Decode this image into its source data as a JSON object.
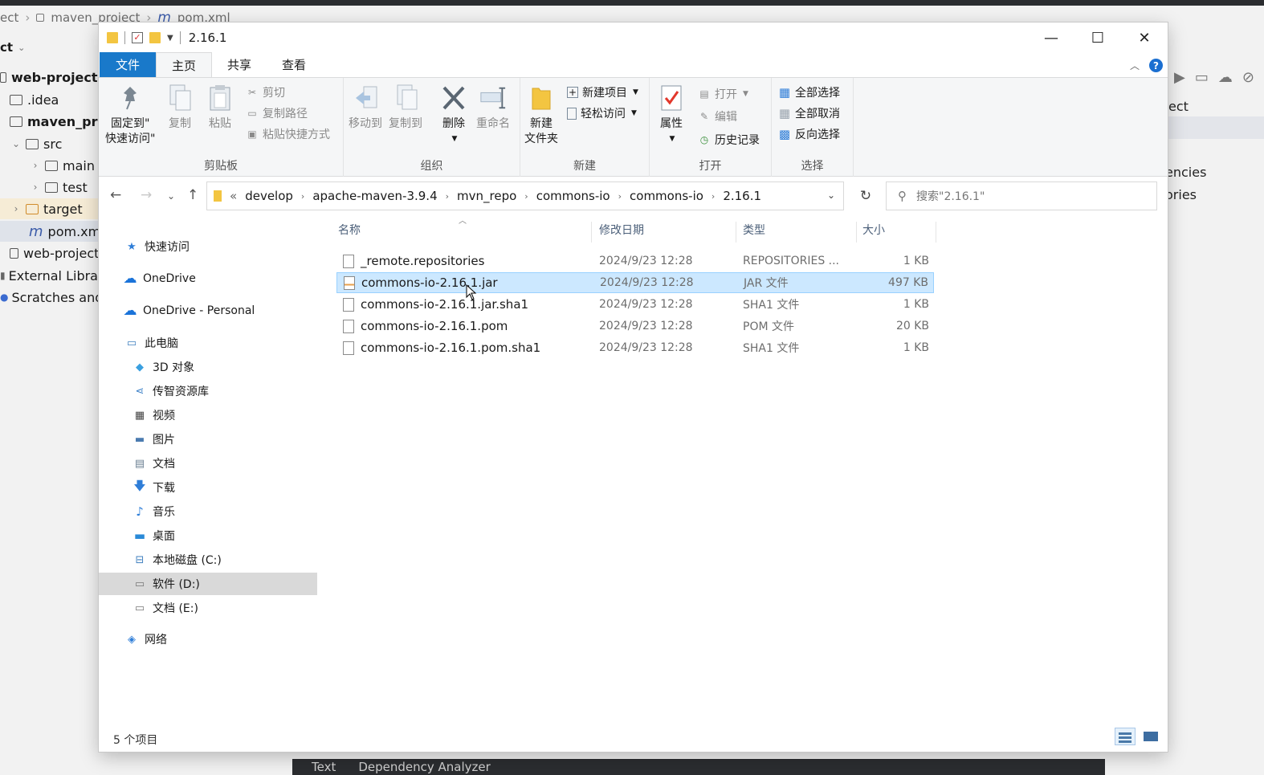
{
  "ide": {
    "breadcrumb": [
      "ect",
      "maven_project",
      "pom.xml"
    ],
    "project_label": "ct",
    "tree": [
      {
        "label": "web-project",
        "bold": true
      },
      {
        "label": ".idea"
      },
      {
        "label": "maven_pro",
        "bold": true
      },
      {
        "label": "src"
      },
      {
        "label": "main"
      },
      {
        "label": "test"
      },
      {
        "label": "target"
      },
      {
        "label": "pom.xml"
      },
      {
        "label": "web-project"
      },
      {
        "label": "External Librari"
      },
      {
        "label": "Scratches and"
      }
    ],
    "right_texts": [
      "ect",
      "encies",
      "ories"
    ],
    "bottom_tabs": [
      "Text",
      "Dependency Analyzer"
    ]
  },
  "window": {
    "title": "2.16.1",
    "buttons": {
      "minimize": "—",
      "maximize": "☐",
      "close": "✕"
    }
  },
  "tabs": {
    "file": "文件",
    "home": "主页",
    "share": "共享",
    "view": "查看"
  },
  "ribbon": {
    "clipboard": {
      "label": "剪贴板",
      "pin": "固定到\"\n快速访问\"",
      "pin_l1": "固定到\"",
      "pin_l2": "快速访问\"",
      "copy": "复制",
      "paste": "粘贴",
      "cut": "剪切",
      "copy_path": "复制路径",
      "paste_shortcut": "粘贴快捷方式"
    },
    "organize": {
      "label": "组织",
      "move_to": "移动到",
      "copy_to": "复制到",
      "delete": "删除",
      "rename": "重命名"
    },
    "new": {
      "label": "新建",
      "new_folder_l1": "新建",
      "new_folder_l2": "文件夹",
      "new_item": "新建项目",
      "easy_access": "轻松访问"
    },
    "open": {
      "label": "打开",
      "properties": "属性",
      "open": "打开",
      "edit": "编辑",
      "history": "历史记录"
    },
    "select": {
      "label": "选择",
      "select_all": "全部选择",
      "select_none": "全部取消",
      "invert": "反向选择"
    }
  },
  "address": {
    "prefix": "«",
    "crumbs": [
      "develop",
      "apache-maven-3.9.4",
      "mvn_repo",
      "commons-io",
      "commons-io",
      "2.16.1"
    ],
    "search_placeholder": "搜索\"2.16.1\""
  },
  "nav": [
    {
      "label": "快速访问",
      "icon": "star-icon"
    },
    {
      "label": "OneDrive",
      "icon": "cloud-icon"
    },
    {
      "label": "OneDrive - Personal",
      "icon": "cloud-icon"
    },
    {
      "label": "此电脑",
      "icon": "computer-icon"
    },
    {
      "label": "3D 对象",
      "icon": "cube-icon"
    },
    {
      "label": "传智资源库",
      "icon": "share-icon"
    },
    {
      "label": "视频",
      "icon": "video-icon"
    },
    {
      "label": "图片",
      "icon": "picture-icon"
    },
    {
      "label": "文档",
      "icon": "document-icon"
    },
    {
      "label": "下载",
      "icon": "download-icon"
    },
    {
      "label": "音乐",
      "icon": "music-icon"
    },
    {
      "label": "桌面",
      "icon": "desktop-icon"
    },
    {
      "label": "本地磁盘 (C:)",
      "icon": "drive-c-icon"
    },
    {
      "label": "软件 (D:)",
      "icon": "drive-icon"
    },
    {
      "label": "文档 (E:)",
      "icon": "drive-icon"
    },
    {
      "label": "网络",
      "icon": "network-icon"
    }
  ],
  "columns": {
    "name": "名称",
    "date": "修改日期",
    "type": "类型",
    "size": "大小"
  },
  "files": [
    {
      "name": "_remote.repositories",
      "date": "2024/9/23 12:28",
      "type": "REPOSITORIES ...",
      "size": "1 KB"
    },
    {
      "name": "commons-io-2.16.1.jar",
      "date": "2024/9/23 12:28",
      "type": "JAR 文件",
      "size": "497 KB"
    },
    {
      "name": "commons-io-2.16.1.jar.sha1",
      "date": "2024/9/23 12:28",
      "type": "SHA1 文件",
      "size": "1 KB"
    },
    {
      "name": "commons-io-2.16.1.pom",
      "date": "2024/9/23 12:28",
      "type": "POM 文件",
      "size": "20 KB"
    },
    {
      "name": "commons-io-2.16.1.pom.sha1",
      "date": "2024/9/23 12:28",
      "type": "SHA1 文件",
      "size": "1 KB"
    }
  ],
  "status": {
    "count": "5 个项目"
  },
  "colors": {
    "accent": "#1979ca",
    "selection": "#cce8ff",
    "folder": "#f3c541"
  }
}
